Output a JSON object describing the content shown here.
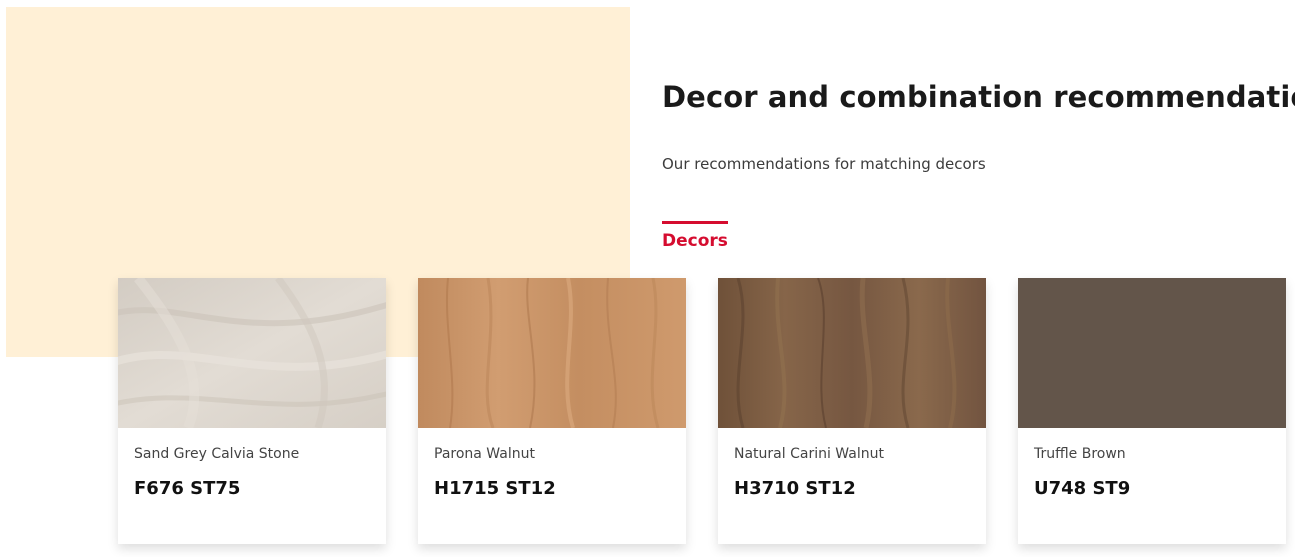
{
  "section": {
    "title": "Decor and combination recommendations",
    "subtitle": "Our recommendations for matching decors"
  },
  "tabs": [
    {
      "label": "Decors",
      "active": true
    }
  ],
  "colors": {
    "accent": "#d50c2f",
    "panel": "#fff0d6"
  },
  "decors": [
    {
      "name": "Sand Grey Calvia Stone",
      "code": "F676 ST75",
      "swatch": "#dcd5cc"
    },
    {
      "name": "Parona Walnut",
      "code": "H1715 ST12",
      "swatch": "#c99468"
    },
    {
      "name": "Natural Carini Walnut",
      "code": "H3710 ST12",
      "swatch": "#7d5e45"
    },
    {
      "name": "Truffle Brown",
      "code": "U748 ST9",
      "swatch": "#63554a"
    }
  ]
}
